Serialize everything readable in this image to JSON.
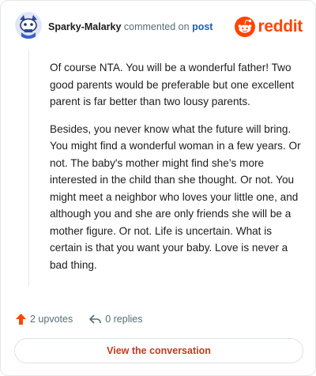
{
  "header": {
    "username": "Sparky-Malarky",
    "action_text": " commented on ",
    "post_link": "post",
    "brand_wordmark": "reddit",
    "avatar_icon": "snoo-avatar-icon",
    "brand_icon": "reddit-logo-icon"
  },
  "comment": {
    "paragraphs": [
      "Of course NTA. You will be a wonderful father! Two good parents would be preferable but one excellent parent is far better than two lousy parents.",
      "Besides, you never know what the future will bring. You might find a wonderful woman in a few years. Or not. The baby's mother might find she’s more interested in the child than she thought. Or not. You might meet a neighbor who loves your little one, and although you and she are only friends she will be a mother figure. Or not. Life is uncertain. What is certain is that you want your baby. Love is never a bad thing."
    ]
  },
  "actions": {
    "upvotes": "2 upvotes",
    "replies": "0 replies",
    "upvote_icon": "upvote-arrow-icon",
    "reply_icon": "reply-arrow-icon"
  },
  "cta": {
    "label": "View the conversation"
  },
  "colors": {
    "brand": "#ff4500",
    "link": "#1f5fb4",
    "cta_text": "#c23a1f",
    "muted": "#576f76"
  }
}
